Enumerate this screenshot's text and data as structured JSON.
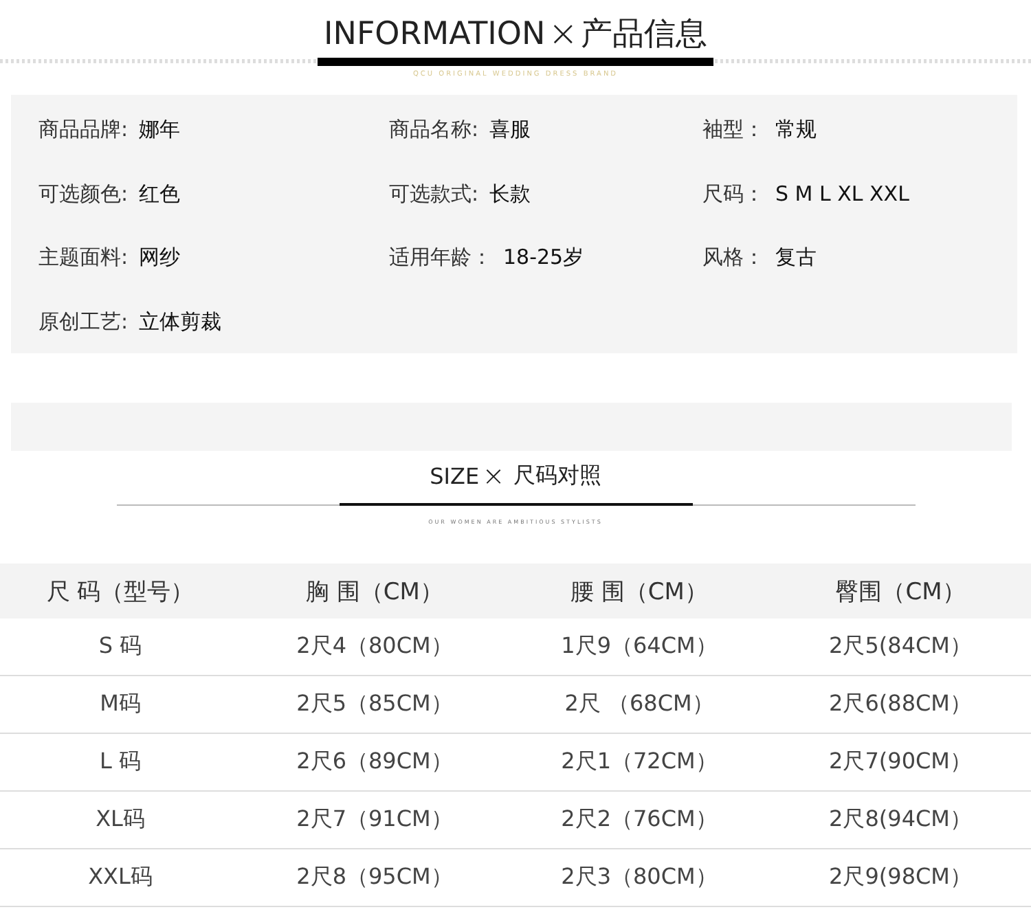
{
  "info_header": {
    "title": "INFORMATION",
    "cross": "×",
    "title_cn": "产品信息",
    "subtitle": "QCU ORIGINAL WEDDING DRESS BRAND"
  },
  "info": [
    {
      "label": "商品品牌:",
      "value": "娜年"
    },
    {
      "label": "商品名称:",
      "value": "喜服"
    },
    {
      "label": "袖型：",
      "value": "常规"
    },
    {
      "label": "可选颜色:",
      "value": "红色"
    },
    {
      "label": "可选款式:",
      "value": "长款"
    },
    {
      "label": "尺码：",
      "value": "S M L XL XXL"
    },
    {
      "label": "主题面料:",
      "value": "网纱"
    },
    {
      "label": "适用年龄：",
      "value": "18-25岁"
    },
    {
      "label": "风格：",
      "value": "复古"
    },
    {
      "label": "原创工艺:",
      "value": "立体剪裁"
    }
  ],
  "size_header": {
    "title": "SIZE",
    "cross": "×",
    "title_cn": "尺码对照",
    "subtitle": "OUR WOMEN ARE AMBITIOUS STYLISTS"
  },
  "size_table": {
    "columns": [
      "尺 码（型号）",
      "胸 围（CM）",
      "腰 围（CM）",
      "臀围（CM）"
    ],
    "rows": [
      [
        "S 码",
        "2尺4（80CM）",
        "1尺9（64CM）",
        "2尺5(84CM）"
      ],
      [
        "M码",
        "2尺5（85CM）",
        "2尺 （68CM）",
        "2尺6(88CM）"
      ],
      [
        "L 码",
        "2尺6（89CM）",
        "2尺1（72CM）",
        "2尺7(90CM）"
      ],
      [
        "XL码",
        "2尺7（91CM）",
        "2尺2（76CM）",
        "2尺8(94CM）"
      ],
      [
        "XXL码",
        "2尺8（95CM）",
        "2尺3（80CM）",
        "2尺9(98CM）"
      ]
    ]
  }
}
